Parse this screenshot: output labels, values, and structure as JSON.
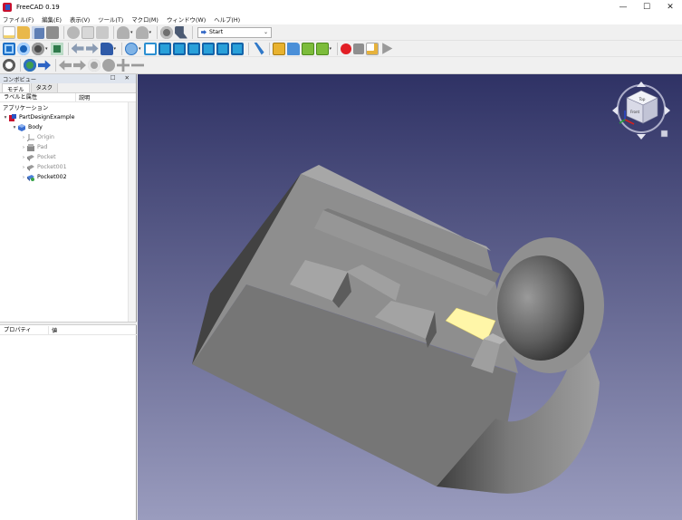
{
  "window": {
    "title": "FreeCAD 0.19",
    "controls": [
      "—",
      "☐",
      "✕"
    ]
  },
  "menu": [
    "ファイル(F)",
    "編集(E)",
    "表示(V)",
    "ツール(T)",
    "マクロ(M)",
    "ウィンドウ(W)",
    "ヘルプ(H)"
  ],
  "workbench": {
    "selected": "Start"
  },
  "combo_view": {
    "title": "コンボビュー",
    "header_buttons": "☐ ✕",
    "tabs": [
      {
        "label": "モデル",
        "active": true
      },
      {
        "label": "タスク",
        "active": false
      }
    ],
    "tree_header": {
      "label_col": "ラベルと属性",
      "desc_col": "説明"
    },
    "application_label": "アプリケーション",
    "tree": [
      {
        "label": "PartDesignExample",
        "level": 0,
        "expand": "▾",
        "icon": "document-icon",
        "color": "#000000"
      },
      {
        "label": "Body",
        "level": 1,
        "expand": "▾",
        "icon": "body-icon",
        "color": "#000000"
      },
      {
        "label": "Origin",
        "level": 2,
        "expand": "›",
        "icon": "origin-icon",
        "color": "#8a8a8a"
      },
      {
        "label": "Pad",
        "level": 2,
        "expand": "›",
        "icon": "pad-icon",
        "color": "#8a8a8a"
      },
      {
        "label": "Pocket",
        "level": 2,
        "expand": "›",
        "icon": "pocket-icon",
        "color": "#8a8a8a"
      },
      {
        "label": "Pocket001",
        "level": 2,
        "expand": "›",
        "icon": "pocket-icon",
        "color": "#8a8a8a"
      },
      {
        "label": "Pocket002",
        "level": 2,
        "expand": "›",
        "icon": "pocket-active-icon",
        "color": "#000000"
      }
    ],
    "property_header": {
      "prop_col": "プロパティ",
      "value_col": "値"
    }
  },
  "navcube": {
    "top": "Top",
    "front": "Front"
  },
  "colors": {
    "viewport_top": "#2f3265",
    "viewport_bottom": "#9a9cbe",
    "model_face": "#8e8e8e",
    "selection": "#fff6a8"
  }
}
